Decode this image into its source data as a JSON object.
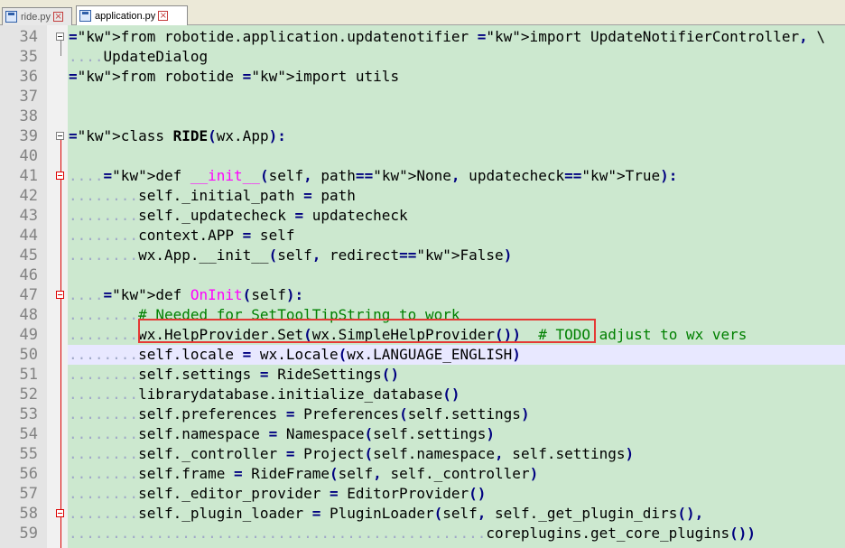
{
  "tabs": [
    {
      "label": "ride.py",
      "active": false
    },
    {
      "label": "application.py",
      "active": true
    }
  ],
  "icons": {
    "file": "python-file-icon",
    "close": "close-tab-icon"
  },
  "colors": {
    "code_background": "#cce8cf",
    "current_line": "#e8e8ff",
    "keyword": "#0000ff",
    "function_name": "#ff00ff",
    "comment": "#008000",
    "annotation_box": "#e53935"
  },
  "editor": {
    "highlighted_line": "50",
    "lines": [
      {
        "num": "34",
        "dots": "",
        "text": "from robotide.application.updatenotifier import UpdateNotifierController, \\"
      },
      {
        "num": "35",
        "dots": "....",
        "text": "UpdateDialog"
      },
      {
        "num": "36",
        "dots": "",
        "text": "from robotide import utils"
      },
      {
        "num": "37",
        "dots": "",
        "text": ""
      },
      {
        "num": "38",
        "dots": "",
        "text": ""
      },
      {
        "num": "39",
        "dots": "",
        "text": "class RIDE(wx.App):"
      },
      {
        "num": "40",
        "dots": "",
        "text": ""
      },
      {
        "num": "41",
        "dots": "....",
        "text": "def __init__(self, path=None, updatecheck=True):"
      },
      {
        "num": "42",
        "dots": "........",
        "text": "self._initial_path = path"
      },
      {
        "num": "43",
        "dots": "........",
        "text": "self._updatecheck = updatecheck"
      },
      {
        "num": "44",
        "dots": "........",
        "text": "context.APP = self"
      },
      {
        "num": "45",
        "dots": "........",
        "text": "wx.App.__init__(self, redirect=False)"
      },
      {
        "num": "46",
        "dots": "",
        "text": ""
      },
      {
        "num": "47",
        "dots": "....",
        "text": "def OnInit(self):"
      },
      {
        "num": "48",
        "dots": "........",
        "text": "# Needed for SetToolTipString to work"
      },
      {
        "num": "49",
        "dots": "........",
        "text": "wx.HelpProvider.Set(wx.SimpleHelpProvider())  # TODO adjust to wx vers"
      },
      {
        "num": "50",
        "dots": "........",
        "text": "self.locale = wx.Locale(wx.LANGUAGE_ENGLISH)"
      },
      {
        "num": "51",
        "dots": "........",
        "text": "self.settings = RideSettings()"
      },
      {
        "num": "52",
        "dots": "........",
        "text": "librarydatabase.initialize_database()"
      },
      {
        "num": "53",
        "dots": "........",
        "text": "self.preferences = Preferences(self.settings)"
      },
      {
        "num": "54",
        "dots": "........",
        "text": "self.namespace = Namespace(self.settings)"
      },
      {
        "num": "55",
        "dots": "........",
        "text": "self._controller = Project(self.namespace, self.settings)"
      },
      {
        "num": "56",
        "dots": "........",
        "text": "self.frame = RideFrame(self, self._controller)"
      },
      {
        "num": "57",
        "dots": "........",
        "text": "self._editor_provider = EditorProvider()"
      },
      {
        "num": "58",
        "dots": "........",
        "text": "self._plugin_loader = PluginLoader(self, self._get_plugin_dirs(),"
      },
      {
        "num": "59",
        "dots": "................................................",
        "text": "coreplugins.get_core_plugins())"
      }
    ]
  }
}
